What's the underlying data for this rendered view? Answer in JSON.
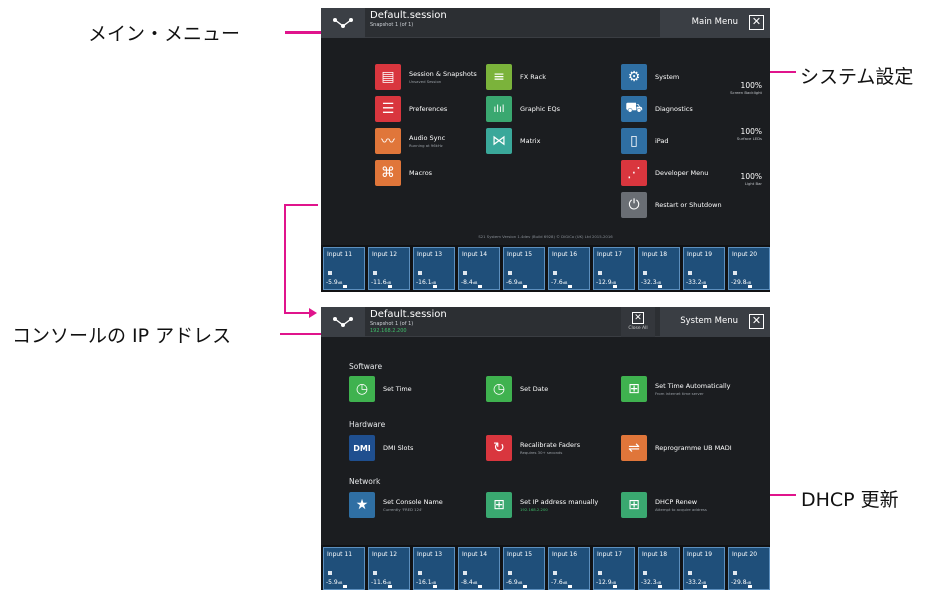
{
  "callouts": {
    "main_menu": "メイン・メニュー",
    "system_settings": "システム設定",
    "console_ip": "コンソールの IP アドレス",
    "dhcp_renew": "DHCP 更新"
  },
  "colors": {
    "callout_line": "#e0148c",
    "background": "#1b1d20",
    "channel_blue": "#1f4f7a",
    "green": "#3fbf6a"
  },
  "screen1": {
    "session": "Default.session",
    "snapshot": "Snapshot 1 (of 1)",
    "menu_title": "Main Menu",
    "close_icon": "✕",
    "items": [
      {
        "label": "Session & Snapshots",
        "sub": "Unsaved Session",
        "icon": "session-icon",
        "color": "#d9363e"
      },
      {
        "label": "Preferences",
        "sub": "",
        "icon": "preferences-icon",
        "color": "#d9363e"
      },
      {
        "label": "Audio Sync",
        "sub": "Running at 96kHz",
        "icon": "audio-sync-icon",
        "color": "#e0763a"
      },
      {
        "label": "Macros",
        "sub": "",
        "icon": "macros-icon",
        "color": "#e0763a"
      },
      {
        "label": "FX Rack",
        "sub": "",
        "icon": "fx-rack-icon",
        "color": "#7bb33b"
      },
      {
        "label": "Graphic EQs",
        "sub": "",
        "icon": "graphic-eq-icon",
        "color": "#3aa870"
      },
      {
        "label": "Matrix",
        "sub": "",
        "icon": "matrix-icon",
        "color": "#3aa89a"
      },
      {
        "label": "System",
        "sub": "",
        "icon": "system-icon",
        "color": "#2f6fa3"
      },
      {
        "label": "Diagnostics",
        "sub": "",
        "icon": "diagnostics-icon",
        "color": "#2f6fa3"
      },
      {
        "label": "iPad",
        "sub": "",
        "icon": "ipad-icon",
        "color": "#2f6fa3"
      },
      {
        "label": "Developer Menu",
        "sub": "",
        "icon": "developer-icon",
        "color": "#d9363e"
      },
      {
        "label": "Restart or Shutdown",
        "sub": "",
        "icon": "power-icon",
        "color": "#6a6e74"
      }
    ],
    "levels": [
      {
        "value": "100%",
        "label": "Screen Backlight"
      },
      {
        "value": "100%",
        "label": "Surface LEDs"
      },
      {
        "value": "100%",
        "label": "Light Bar"
      }
    ],
    "version": "S21 System Version 1.4dev (Build 6928) © DiGiCo (UK) Ltd 2015-2016"
  },
  "screen2": {
    "session": "Default.session",
    "snapshot": "Snapshot 1 (of 1)",
    "ip_address": "192.168.2.200",
    "close_all_label": "Close All",
    "menu_title": "System Menu",
    "close_icon": "✕",
    "sections": {
      "software": "Software",
      "hardware": "Hardware",
      "network": "Network"
    },
    "items": [
      {
        "label": "Set Time",
        "sub": "",
        "icon": "clock-icon",
        "color": "#3fb24f"
      },
      {
        "label": "Set Date",
        "sub": "",
        "icon": "clock-icon",
        "color": "#3fb24f"
      },
      {
        "label": "Set Time Automatically",
        "sub": "From internet time server",
        "icon": "network-icon",
        "color": "#3fb24f"
      },
      {
        "label": "DMI Slots",
        "sub": "",
        "icon": "dmi-icon",
        "color": "#1f4f8f"
      },
      {
        "label": "Recalibrate Faders",
        "sub": "Requires 30+ seconds",
        "icon": "recalibrate-icon",
        "color": "#d9363e"
      },
      {
        "label": "Reprogramme UB MADI",
        "sub": "",
        "icon": "usb-icon",
        "color": "#e0763a"
      },
      {
        "label": "Set Console Name",
        "sub": "Currently 'FRED 124'",
        "icon": "star-icon",
        "color": "#2f6fa3"
      },
      {
        "label": "Set IP address manually",
        "sub": "192.168.2.200",
        "icon": "network-icon",
        "color": "#3aa870"
      },
      {
        "label": "DHCP Renew",
        "sub": "Attempt to acquire address",
        "icon": "network-icon",
        "color": "#3aa870"
      }
    ]
  },
  "channels": [
    {
      "name": "Input 11",
      "level": "-5.9",
      "unit": "dB"
    },
    {
      "name": "Input 12",
      "level": "-11.6",
      "unit": "dB"
    },
    {
      "name": "Input 13",
      "level": "-16.1",
      "unit": "dB"
    },
    {
      "name": "Input 14",
      "level": "-8.4",
      "unit": "dB"
    },
    {
      "name": "Input 15",
      "level": "-6.9",
      "unit": "dB"
    },
    {
      "name": "Input 16",
      "level": "-7.6",
      "unit": "dB"
    },
    {
      "name": "Input 17",
      "level": "-12.9",
      "unit": "dB"
    },
    {
      "name": "Input 18",
      "level": "-32.3",
      "unit": "dB"
    },
    {
      "name": "Input 19",
      "level": "-33.2",
      "unit": "dB"
    },
    {
      "name": "Input 20",
      "level": "-29.8",
      "unit": "dB"
    }
  ]
}
